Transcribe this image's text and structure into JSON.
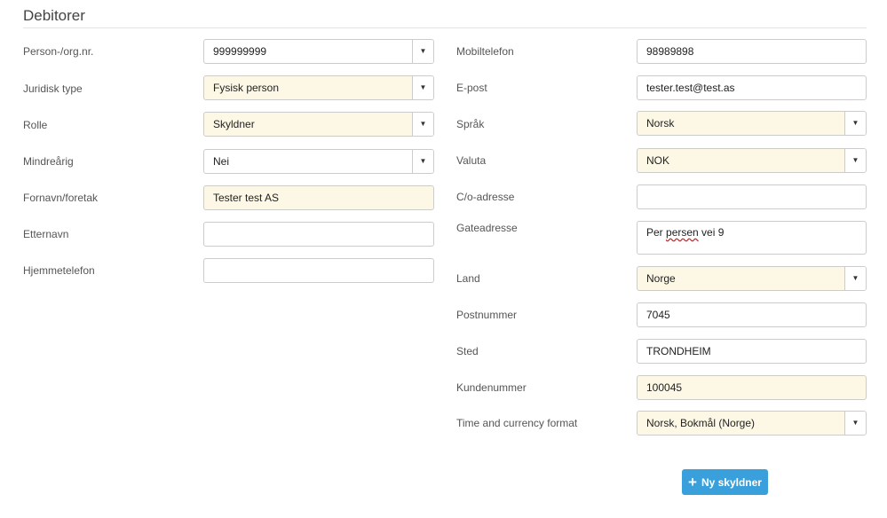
{
  "page": {
    "title": "Debitorer"
  },
  "left": {
    "person_org": {
      "label": "Person-/org.nr.",
      "value": "999999999"
    },
    "juridisk_type": {
      "label": "Juridisk type",
      "value": "Fysisk person"
    },
    "rolle": {
      "label": "Rolle",
      "value": "Skyldner"
    },
    "mindrearig": {
      "label": "Mindreårig",
      "value": "Nei"
    },
    "fornavn": {
      "label": "Fornavn/foretak",
      "value": "Tester test AS"
    },
    "etternavn": {
      "label": "Etternavn",
      "value": ""
    },
    "hjemmetelefon": {
      "label": "Hjemmetelefon",
      "value": ""
    }
  },
  "right": {
    "mobiltelefon": {
      "label": "Mobiltelefon",
      "value": "98989898"
    },
    "epost": {
      "label": "E-post",
      "value": "tester.test@test.as"
    },
    "sprak": {
      "label": "Språk",
      "value": "Norsk"
    },
    "valuta": {
      "label": "Valuta",
      "value": "NOK"
    },
    "co_adresse": {
      "label": "C/o-adresse",
      "value": ""
    },
    "gateadresse": {
      "label": "Gateadresse",
      "value_prefix": "Per ",
      "value_spell": "persen",
      "value_suffix": " vei 9"
    },
    "land": {
      "label": "Land",
      "value": "Norge"
    },
    "postnummer": {
      "label": "Postnummer",
      "value": "7045"
    },
    "sted": {
      "label": "Sted",
      "value": "TRONDHEIM"
    },
    "kundenummer": {
      "label": "Kundenummer",
      "value": "100045"
    },
    "time_currency": {
      "label": "Time and currency format",
      "value": "Norsk, Bokmål (Norge)"
    }
  },
  "actions": {
    "new_debtor_label": "Ny skyldner",
    "new_debtor_icon": "plus-icon"
  },
  "colors": {
    "required_bg": "#fdf8e5",
    "button_bg": "#3aa0dc",
    "border": "#cccccc"
  }
}
